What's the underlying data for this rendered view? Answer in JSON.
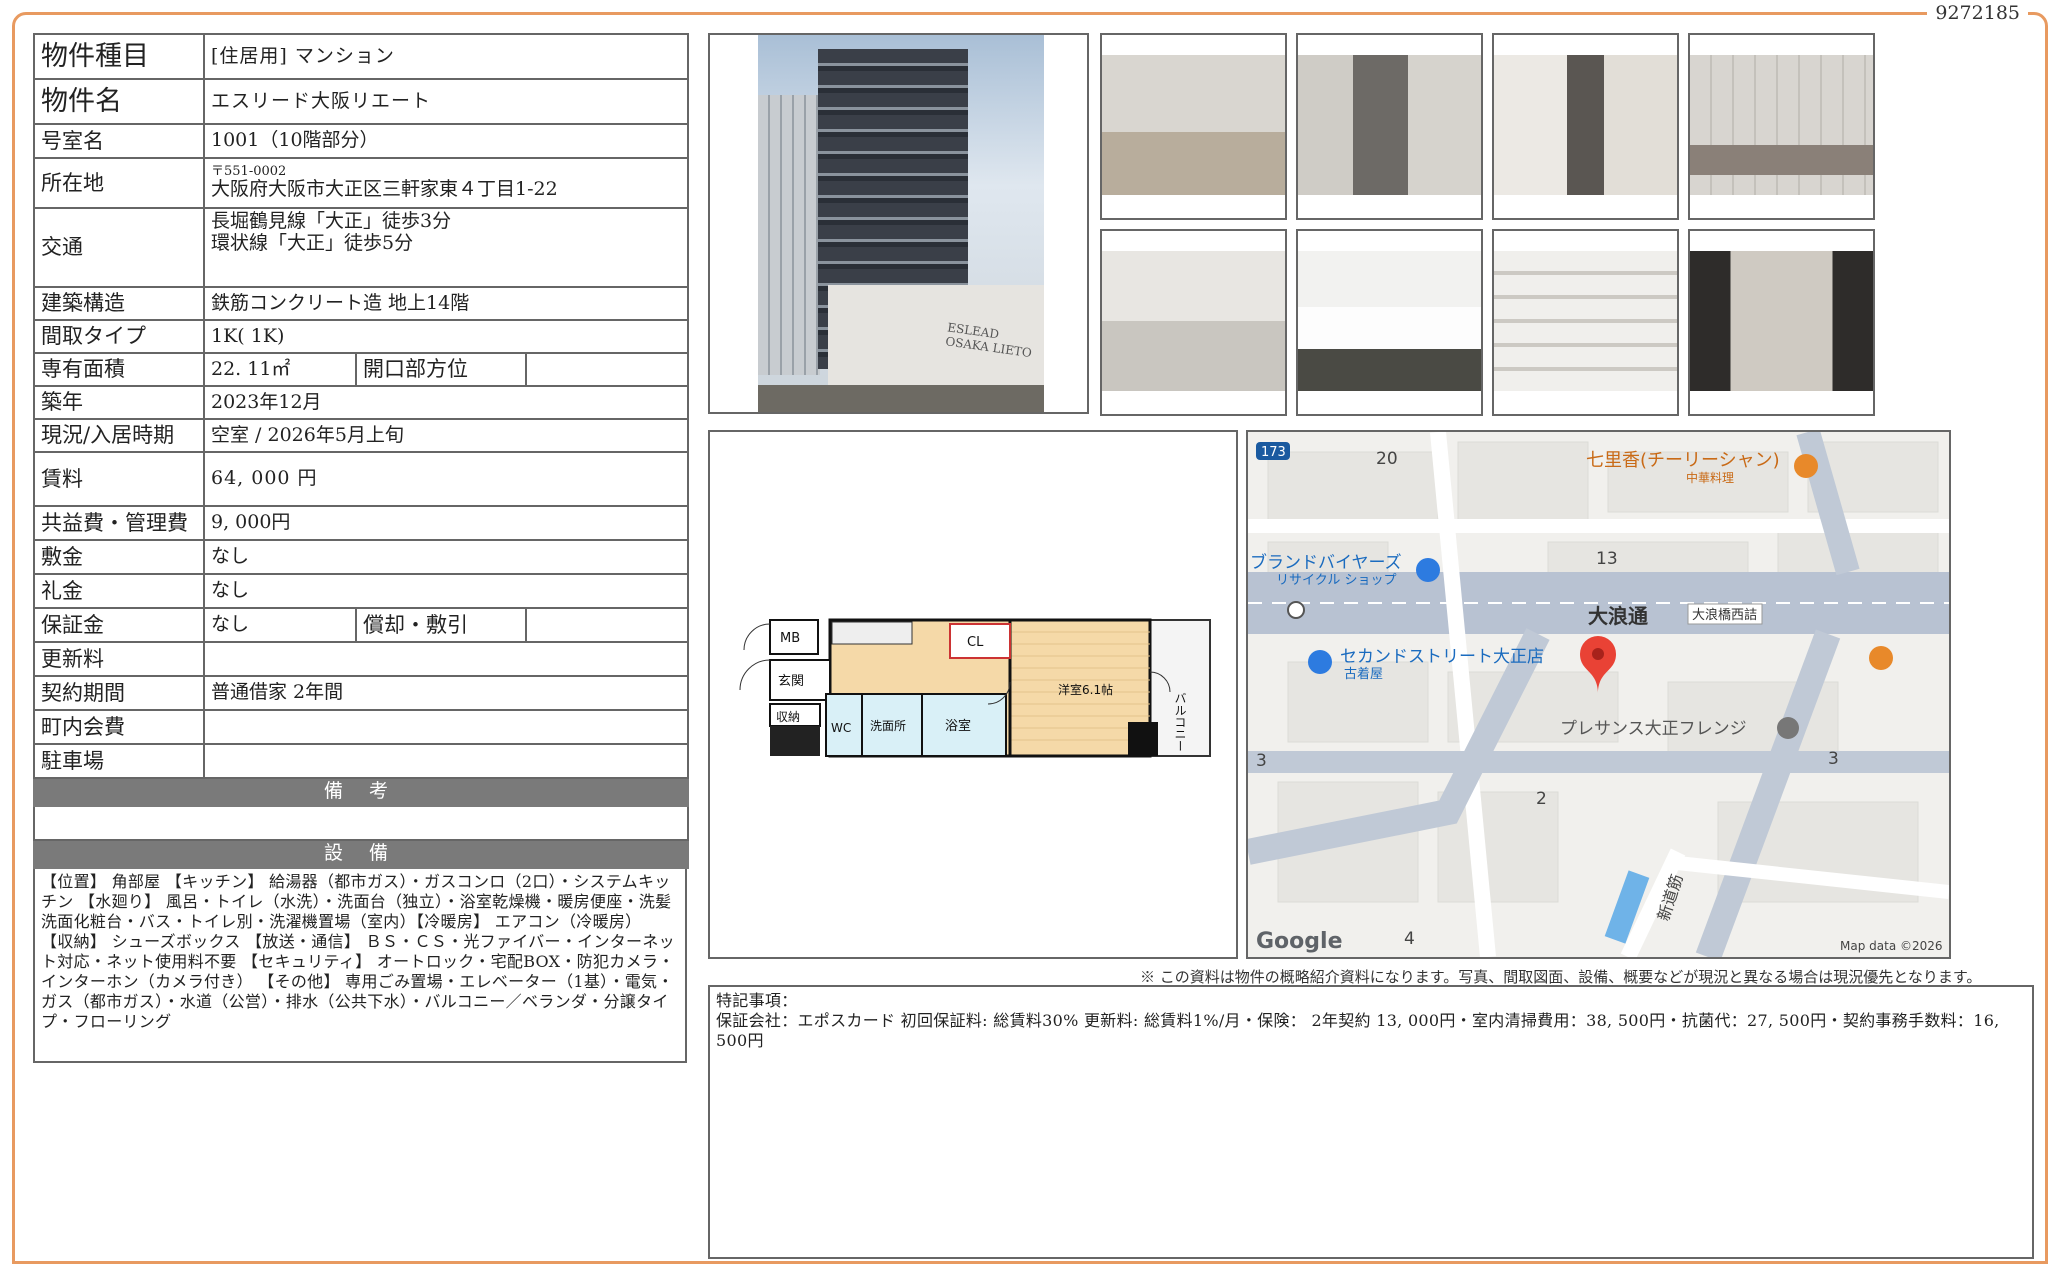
{
  "doc_id": "9272185",
  "info": {
    "type": {
      "label": "物件種目",
      "value": "[住居用]  マンション"
    },
    "name": {
      "label": "物件名",
      "value": "エスリード大阪リエート"
    },
    "room": {
      "label": "号室名",
      "value": "1001（10階部分）"
    },
    "address": {
      "label": "所在地",
      "zip": "〒551-0002",
      "value": "大阪府大阪市大正区三軒家東４丁目1-22"
    },
    "transit": {
      "label": "交通",
      "line1": "長堀鶴見線「大正」徒歩3分",
      "line2": "環状線「大正」徒歩5分"
    },
    "structure": {
      "label": "建築構造",
      "value": "鉄筋コンクリート造  地上14階"
    },
    "layout": {
      "label": "間取タイプ",
      "value": "1K( 1K)"
    },
    "area": {
      "label": "専有面積",
      "value": "22. 11㎡",
      "sub_label": "開口部方位",
      "sub_value": ""
    },
    "built": {
      "label": "築年",
      "value": "2023年12月"
    },
    "status": {
      "label": "現況/入居時期",
      "value": "空室  /  2026年5月上旬"
    },
    "rent": {
      "label": "賃料",
      "value": "64, 000 円"
    },
    "mgmt": {
      "label": "共益費・管理費",
      "value": "9, 000円"
    },
    "deposit": {
      "label": "敷金",
      "value": "なし"
    },
    "key_money": {
      "label": "礼金",
      "value": "なし"
    },
    "guarantee": {
      "label": "保証金",
      "value": "なし",
      "sub_label": "償却・敷引",
      "sub_value": ""
    },
    "renewal": {
      "label": "更新料",
      "value": ""
    },
    "contract": {
      "label": "契約期間",
      "value": "普通借家  2年間"
    },
    "town_fee": {
      "label": "町内会費",
      "value": ""
    },
    "parking": {
      "label": "駐車場",
      "value": ""
    },
    "remarks_head": "備  考",
    "remarks": "",
    "equipment_head": "設  備",
    "equipment": "【位置】 角部屋 【キッチン】 給湯器（都市ガス）・ガスコンロ（2口）・システムキッチン 【水廻り】 風呂・トイレ（水洗）・洗面台（独立）・浴室乾燥機・暖房便座・洗髪洗面化粧台・バス・トイレ別・洗濯機置場（室内）【冷暖房】 エアコン（冷暖房） 【収納】 シューズボックス 【放送・通信】 ＢＳ・ＣＳ・光ファイバー・インターネット対応・ネット使用料不要 【セキュリティ】 オートロック・宅配BOX・防犯カメラ・インターホン（カメラ付き） 【その他】 専用ごみ置場・エレベーター（1基）・電気・ガス（都市ガス）・水道（公営）・排水（公共下水）・バルコニー／ベランダ・分譲タイプ・フローリング"
  },
  "building_sign": "ESLEAD OSAKA LIETO",
  "floor_plan": {
    "rooms": [
      "MB",
      "CL",
      "玄関",
      "収納",
      "WC",
      "洗面所",
      "浴室",
      "洋室6.1帖",
      "バルコニー"
    ]
  },
  "map": {
    "labels": {
      "restaurant": "七里香(チーリーシャン)",
      "restaurant_sub": "中華料理",
      "shop1": "ブランドバイヤーズ",
      "shop1_sub": "リサイクル ショップ",
      "shop2": "セカンドストリート大正店",
      "shop2_sub": "古着屋",
      "avenue": "大浪通",
      "intersection": "大浪橋西詰",
      "building": "プレサンス大正フレンジ",
      "street": "新道筋",
      "route": "173",
      "block_20": "20",
      "block_13": "13",
      "block_3a": "3",
      "block_3b": "3",
      "block_2": "2",
      "block_4": "4",
      "google": "Google",
      "credit": "Map data ©2026"
    }
  },
  "disclaimer": "※ この資料は物件の概略紹介資料になります。写真、間取図面、設備、概要などが現況と異なる場合は現況優先となります。",
  "notes": {
    "title": "特記事項：",
    "body": "保証会社：エポスカード 初回保証料: 総賃料30% 更新料: 総賃料1%/月・保険： 2年契約 13, 000円・室内清掃費用：38, 500円・抗菌代：27, 500円・契約事務手数料：16, 500円"
  }
}
